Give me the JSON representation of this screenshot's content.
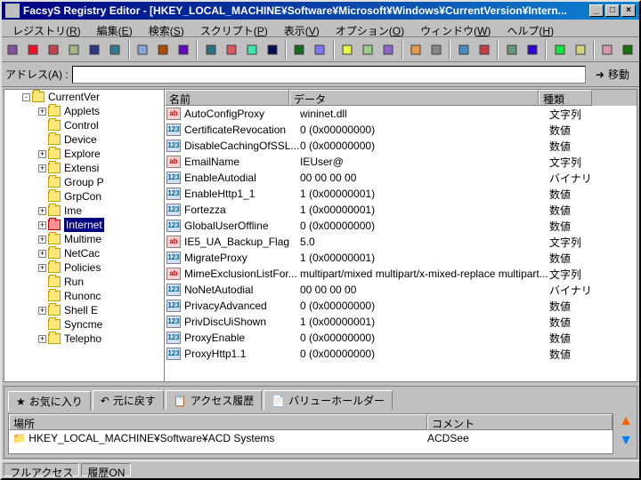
{
  "window": {
    "title": "FacsyS Registry Editor - [HKEY_LOCAL_MACHINE¥Software¥Microsoft¥Windows¥CurrentVersion¥Intern..."
  },
  "menu": {
    "items": [
      {
        "label": "レジストリ",
        "accel": "R"
      },
      {
        "label": "編集",
        "accel": "E"
      },
      {
        "label": "検索",
        "accel": "S"
      },
      {
        "label": "スクリプト",
        "accel": "P"
      },
      {
        "label": "表示",
        "accel": "V"
      },
      {
        "label": "オプション",
        "accel": "O"
      },
      {
        "label": "ウィンドウ",
        "accel": "W"
      },
      {
        "label": "ヘルプ",
        "accel": "H"
      }
    ]
  },
  "address": {
    "label": "アドレス(A) :",
    "value": "",
    "go_label": "移動"
  },
  "tree": {
    "root": "CurrentVer",
    "items": [
      {
        "label": "Applets",
        "indent": 1,
        "exp": "+"
      },
      {
        "label": "Control",
        "indent": 1,
        "exp": ""
      },
      {
        "label": "Device",
        "indent": 1,
        "exp": ""
      },
      {
        "label": "Explore",
        "indent": 1,
        "exp": "+"
      },
      {
        "label": "Extensi",
        "indent": 1,
        "exp": "+"
      },
      {
        "label": "Group P",
        "indent": 1,
        "exp": ""
      },
      {
        "label": "GrpCon",
        "indent": 1,
        "exp": ""
      },
      {
        "label": "Ime",
        "indent": 1,
        "exp": "+"
      },
      {
        "label": "Internet",
        "indent": 1,
        "exp": "+",
        "selected": true,
        "red": true
      },
      {
        "label": "Multime",
        "indent": 1,
        "exp": "+"
      },
      {
        "label": "NetCac",
        "indent": 1,
        "exp": "+"
      },
      {
        "label": "Policies",
        "indent": 1,
        "exp": "+"
      },
      {
        "label": "Run",
        "indent": 1,
        "exp": ""
      },
      {
        "label": "Runonc",
        "indent": 1,
        "exp": ""
      },
      {
        "label": "Shell E",
        "indent": 1,
        "exp": "+"
      },
      {
        "label": "Syncme",
        "indent": 1,
        "exp": ""
      },
      {
        "label": "Telepho",
        "indent": 1,
        "exp": "+"
      }
    ]
  },
  "list": {
    "headers": {
      "name": "名前",
      "data": "データ",
      "type": "種類"
    },
    "rows": [
      {
        "icon": "ab",
        "name": "AutoConfigProxy",
        "data": "wininet.dll",
        "type": "文字列"
      },
      {
        "icon": "num",
        "name": "CertificateRevocation",
        "data": "0 (0x00000000)",
        "type": "数値"
      },
      {
        "icon": "num",
        "name": "DisableCachingOfSSL...",
        "data": "0 (0x00000000)",
        "type": "数値"
      },
      {
        "icon": "ab",
        "name": "EmailName",
        "data": "IEUser@",
        "type": "文字列"
      },
      {
        "icon": "num",
        "name": "EnableAutodial",
        "data": "00 00 00 00",
        "type": "バイナリ"
      },
      {
        "icon": "num",
        "name": "EnableHttp1_1",
        "data": "1 (0x00000001)",
        "type": "数値"
      },
      {
        "icon": "num",
        "name": "Fortezza",
        "data": "1 (0x00000001)",
        "type": "数値"
      },
      {
        "icon": "num",
        "name": "GlobalUserOffline",
        "data": "0 (0x00000000)",
        "type": "数値"
      },
      {
        "icon": "ab",
        "name": "IE5_UA_Backup_Flag",
        "data": "5.0",
        "type": "文字列"
      },
      {
        "icon": "num",
        "name": "MigrateProxy",
        "data": "1 (0x00000001)",
        "type": "数値"
      },
      {
        "icon": "ab",
        "name": "MimeExclusionListFor...",
        "data": "multipart/mixed multipart/x-mixed-replace multipart...",
        "type": "文字列"
      },
      {
        "icon": "num",
        "name": "NoNetAutodial",
        "data": "00 00 00 00",
        "type": "バイナリ"
      },
      {
        "icon": "num",
        "name": "PrivacyAdvanced",
        "data": "0 (0x00000000)",
        "type": "数値"
      },
      {
        "icon": "num",
        "name": "PrivDiscUiShown",
        "data": "1 (0x00000001)",
        "type": "数値"
      },
      {
        "icon": "num",
        "name": "ProxyEnable",
        "data": "0 (0x00000000)",
        "type": "数値"
      },
      {
        "icon": "num",
        "name": "ProxyHttp1.1",
        "data": "0 (0x00000000)",
        "type": "数値"
      }
    ]
  },
  "tabs": {
    "items": [
      {
        "label": "お気に入り",
        "icon": "star",
        "active": true
      },
      {
        "label": "元に戻す",
        "icon": "undo"
      },
      {
        "label": "アクセス履歴",
        "icon": "history"
      },
      {
        "label": "バリューホールダー",
        "icon": "holder"
      }
    ]
  },
  "favorites": {
    "headers": {
      "place": "場所",
      "comment": "コメント"
    },
    "rows": [
      {
        "place": "HKEY_LOCAL_MACHINE¥Software¥ACD Systems",
        "comment": "ACDSee"
      }
    ]
  },
  "statusbar": {
    "access": "フルアクセス",
    "history": "履歴ON"
  },
  "iconbar": {
    "icons": [
      "print-icon",
      "copy-icon",
      "reconnect-icon",
      "info-icon",
      "table-view-icon",
      "star-icon",
      "sep",
      "refresh-icon",
      "play-icon",
      "stop-icon",
      "sep",
      "new-key-icon",
      "new-string-icon",
      "new-dword-icon",
      "new-binary-icon",
      "sep",
      "cascade-icon",
      "tile-icon",
      "sep",
      "cut-icon",
      "copy2-icon",
      "paste-icon",
      "sep",
      "binoculars-icon",
      "find-next-icon",
      "sep",
      "bookmark-icon",
      "settings-icon",
      "sep",
      "open-icon",
      "save-icon",
      "sep",
      "key-icon",
      "folder-icon",
      "sep",
      "scissors-icon",
      "clipboard-icon"
    ]
  }
}
